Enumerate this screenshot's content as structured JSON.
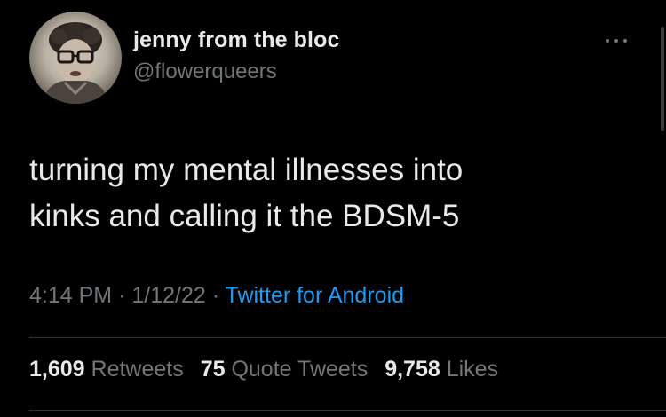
{
  "user": {
    "display_name": "jenny from the bloc",
    "handle": "@flowerqueers"
  },
  "tweet": {
    "text_lines": [
      "turning my mental illnesses into",
      "kinks and calling it the BDSM-5"
    ],
    "time": "4:14 PM",
    "separator": "·",
    "date": "1/12/22",
    "source": "Twitter for Android"
  },
  "stats": {
    "retweets": {
      "count": "1,609",
      "label": "Retweets"
    },
    "quote_tweets": {
      "count": "75",
      "label": "Quote Tweets"
    },
    "likes": {
      "count": "9,758",
      "label": "Likes"
    }
  },
  "icons": {
    "more": "more-options-icon"
  },
  "colors": {
    "background": "#000000",
    "primary_text": "#e7e9ea",
    "secondary_text": "#71767b",
    "link": "#1d9bf0",
    "divider": "#2f3336"
  }
}
